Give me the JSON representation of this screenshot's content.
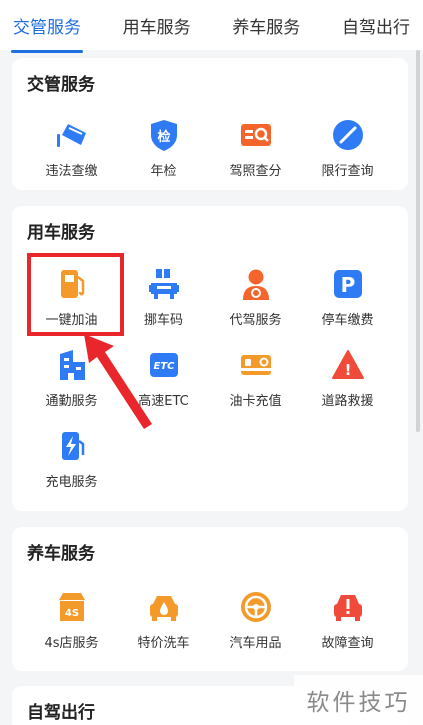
{
  "tabs": [
    {
      "label": "交管服务",
      "active": true
    },
    {
      "label": "用车服务",
      "active": false
    },
    {
      "label": "养车服务",
      "active": false
    },
    {
      "label": "自驾出行",
      "active": false
    }
  ],
  "sections": {
    "traffic": {
      "title": "交管服务",
      "items": [
        {
          "label": "违法查缴",
          "icon": "camera-icon"
        },
        {
          "label": "年检",
          "icon": "inspection-shield-icon",
          "glyph": "检"
        },
        {
          "label": "驾照查分",
          "icon": "license-card-icon"
        },
        {
          "label": "限行查询",
          "icon": "no-entry-icon"
        }
      ]
    },
    "car_use": {
      "title": "用车服务",
      "items": [
        {
          "label": "一键加油",
          "icon": "fuel-pump-icon"
        },
        {
          "label": "挪车码",
          "icon": "move-car-icon"
        },
        {
          "label": "代驾服务",
          "icon": "driver-icon"
        },
        {
          "label": "停车缴费",
          "icon": "parking-icon",
          "glyph": "P"
        },
        {
          "label": "通勤服务",
          "icon": "commute-building-icon"
        },
        {
          "label": "高速ETC",
          "icon": "etc-icon",
          "glyph": "ETC"
        },
        {
          "label": "油卡充值",
          "icon": "fuel-card-icon"
        },
        {
          "label": "道路救援",
          "icon": "warning-icon",
          "glyph": "!"
        },
        {
          "label": "充电服务",
          "icon": "charging-icon"
        }
      ]
    },
    "maintenance": {
      "title": "养车服务",
      "items": [
        {
          "label": "4s店服务",
          "icon": "4s-store-icon",
          "glyph": "4S"
        },
        {
          "label": "特价洗车",
          "icon": "car-wash-icon"
        },
        {
          "label": "汽车用品",
          "icon": "steering-wheel-icon"
        },
        {
          "label": "故障查询",
          "icon": "fault-car-icon"
        }
      ]
    },
    "self_drive": {
      "title": "自驾出行"
    }
  },
  "watermark": "软件技巧",
  "colors": {
    "accent_blue": "#1e6fe0",
    "icon_blue": "#2f7bf5",
    "icon_orange": "#f39a2b",
    "icon_red": "#f04b3a",
    "highlight_red": "#e8262c"
  }
}
